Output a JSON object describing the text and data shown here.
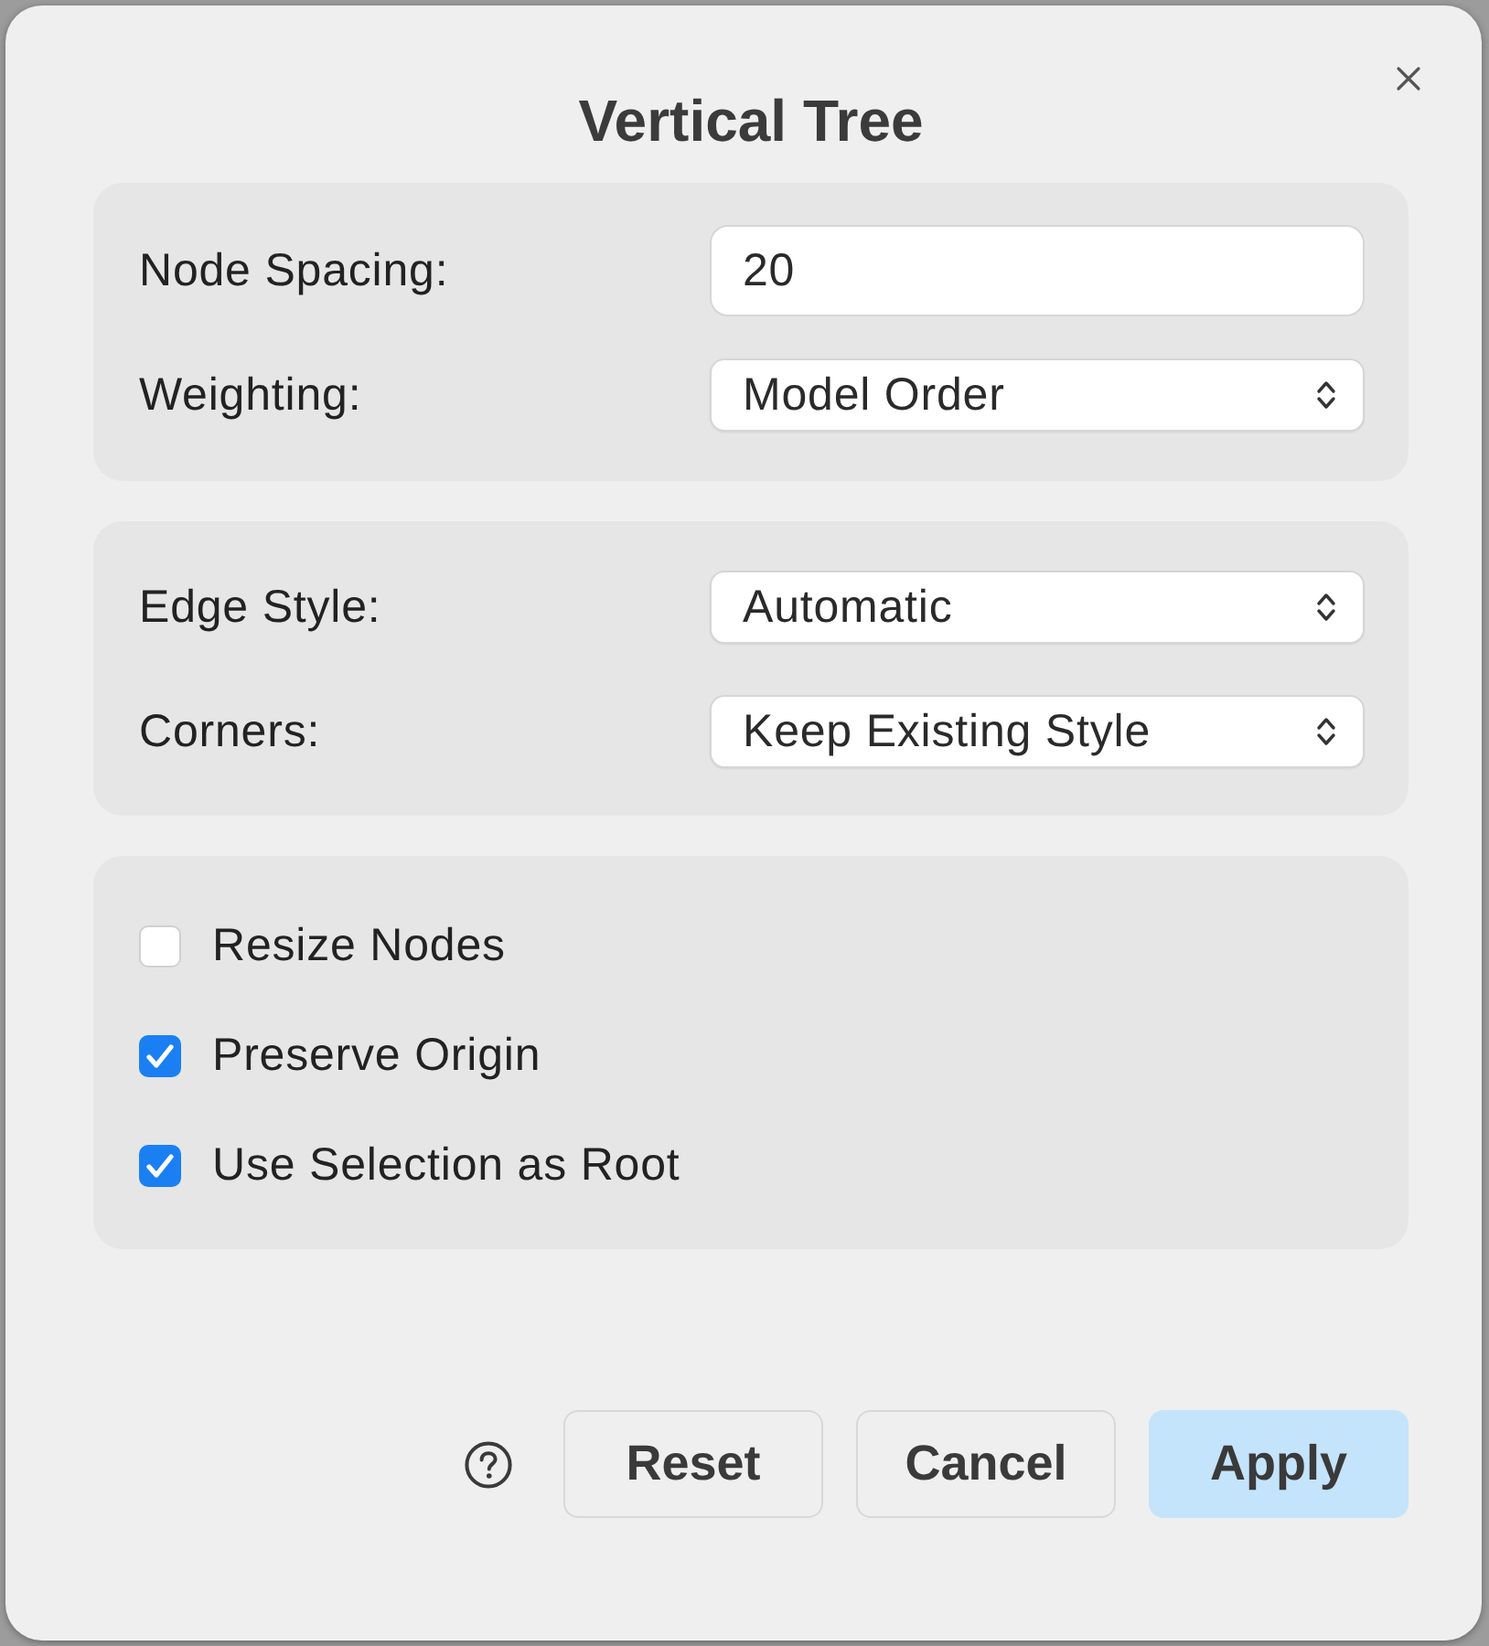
{
  "dialog": {
    "title": "Vertical Tree"
  },
  "sections": [
    {
      "kind": "fields",
      "rows": [
        {
          "kind": "text",
          "label": "Node Spacing:",
          "value": "20"
        },
        {
          "kind": "select",
          "label": "Weighting:",
          "value": "Model Order"
        }
      ]
    },
    {
      "kind": "fields",
      "rows": [
        {
          "kind": "select",
          "label": "Edge Style:",
          "value": "Automatic"
        },
        {
          "kind": "select",
          "label": "Corners:",
          "value": "Keep Existing Style"
        }
      ]
    },
    {
      "kind": "checkboxes",
      "rows": [
        {
          "label": "Resize Nodes",
          "checked": false
        },
        {
          "label": "Preserve Origin",
          "checked": true
        },
        {
          "label": "Use Selection as Root",
          "checked": true
        }
      ]
    }
  ],
  "buttons": [
    {
      "label": "Reset",
      "default": false
    },
    {
      "label": "Cancel",
      "default": false
    },
    {
      "label": "Apply",
      "default": true
    }
  ]
}
